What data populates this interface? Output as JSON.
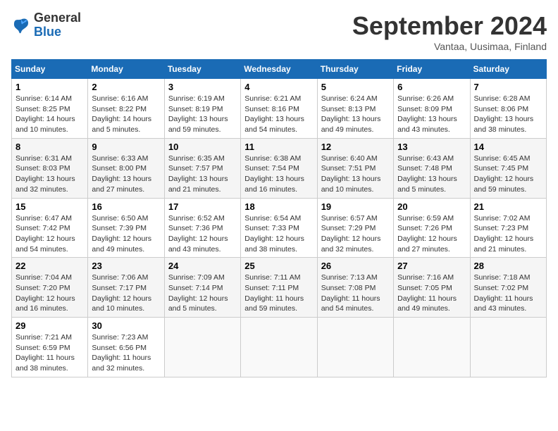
{
  "header": {
    "logo": {
      "general": "General",
      "blue": "Blue"
    },
    "title": "September 2024",
    "subtitle": "Vantaa, Uusimaa, Finland"
  },
  "calendar": {
    "days_of_week": [
      "Sunday",
      "Monday",
      "Tuesday",
      "Wednesday",
      "Thursday",
      "Friday",
      "Saturday"
    ],
    "weeks": [
      [
        {
          "day": "1",
          "sunrise": "6:14 AM",
          "sunset": "8:25 PM",
          "daylight": "14 hours and 10 minutes."
        },
        {
          "day": "2",
          "sunrise": "6:16 AM",
          "sunset": "8:22 PM",
          "daylight": "14 hours and 5 minutes."
        },
        {
          "day": "3",
          "sunrise": "6:19 AM",
          "sunset": "8:19 PM",
          "daylight": "13 hours and 59 minutes."
        },
        {
          "day": "4",
          "sunrise": "6:21 AM",
          "sunset": "8:16 PM",
          "daylight": "13 hours and 54 minutes."
        },
        {
          "day": "5",
          "sunrise": "6:24 AM",
          "sunset": "8:13 PM",
          "daylight": "13 hours and 49 minutes."
        },
        {
          "day": "6",
          "sunrise": "6:26 AM",
          "sunset": "8:09 PM",
          "daylight": "13 hours and 43 minutes."
        },
        {
          "day": "7",
          "sunrise": "6:28 AM",
          "sunset": "8:06 PM",
          "daylight": "13 hours and 38 minutes."
        }
      ],
      [
        {
          "day": "8",
          "sunrise": "6:31 AM",
          "sunset": "8:03 PM",
          "daylight": "13 hours and 32 minutes."
        },
        {
          "day": "9",
          "sunrise": "6:33 AM",
          "sunset": "8:00 PM",
          "daylight": "13 hours and 27 minutes."
        },
        {
          "day": "10",
          "sunrise": "6:35 AM",
          "sunset": "7:57 PM",
          "daylight": "13 hours and 21 minutes."
        },
        {
          "day": "11",
          "sunrise": "6:38 AM",
          "sunset": "7:54 PM",
          "daylight": "13 hours and 16 minutes."
        },
        {
          "day": "12",
          "sunrise": "6:40 AM",
          "sunset": "7:51 PM",
          "daylight": "13 hours and 10 minutes."
        },
        {
          "day": "13",
          "sunrise": "6:43 AM",
          "sunset": "7:48 PM",
          "daylight": "13 hours and 5 minutes."
        },
        {
          "day": "14",
          "sunrise": "6:45 AM",
          "sunset": "7:45 PM",
          "daylight": "12 hours and 59 minutes."
        }
      ],
      [
        {
          "day": "15",
          "sunrise": "6:47 AM",
          "sunset": "7:42 PM",
          "daylight": "12 hours and 54 minutes."
        },
        {
          "day": "16",
          "sunrise": "6:50 AM",
          "sunset": "7:39 PM",
          "daylight": "12 hours and 49 minutes."
        },
        {
          "day": "17",
          "sunrise": "6:52 AM",
          "sunset": "7:36 PM",
          "daylight": "12 hours and 43 minutes."
        },
        {
          "day": "18",
          "sunrise": "6:54 AM",
          "sunset": "7:33 PM",
          "daylight": "12 hours and 38 minutes."
        },
        {
          "day": "19",
          "sunrise": "6:57 AM",
          "sunset": "7:29 PM",
          "daylight": "12 hours and 32 minutes."
        },
        {
          "day": "20",
          "sunrise": "6:59 AM",
          "sunset": "7:26 PM",
          "daylight": "12 hours and 27 minutes."
        },
        {
          "day": "21",
          "sunrise": "7:02 AM",
          "sunset": "7:23 PM",
          "daylight": "12 hours and 21 minutes."
        }
      ],
      [
        {
          "day": "22",
          "sunrise": "7:04 AM",
          "sunset": "7:20 PM",
          "daylight": "12 hours and 16 minutes."
        },
        {
          "day": "23",
          "sunrise": "7:06 AM",
          "sunset": "7:17 PM",
          "daylight": "12 hours and 10 minutes."
        },
        {
          "day": "24",
          "sunrise": "7:09 AM",
          "sunset": "7:14 PM",
          "daylight": "12 hours and 5 minutes."
        },
        {
          "day": "25",
          "sunrise": "7:11 AM",
          "sunset": "7:11 PM",
          "daylight": "11 hours and 59 minutes."
        },
        {
          "day": "26",
          "sunrise": "7:13 AM",
          "sunset": "7:08 PM",
          "daylight": "11 hours and 54 minutes."
        },
        {
          "day": "27",
          "sunrise": "7:16 AM",
          "sunset": "7:05 PM",
          "daylight": "11 hours and 49 minutes."
        },
        {
          "day": "28",
          "sunrise": "7:18 AM",
          "sunset": "7:02 PM",
          "daylight": "11 hours and 43 minutes."
        }
      ],
      [
        {
          "day": "29",
          "sunrise": "7:21 AM",
          "sunset": "6:59 PM",
          "daylight": "11 hours and 38 minutes."
        },
        {
          "day": "30",
          "sunrise": "7:23 AM",
          "sunset": "6:56 PM",
          "daylight": "11 hours and 32 minutes."
        },
        null,
        null,
        null,
        null,
        null
      ]
    ]
  }
}
